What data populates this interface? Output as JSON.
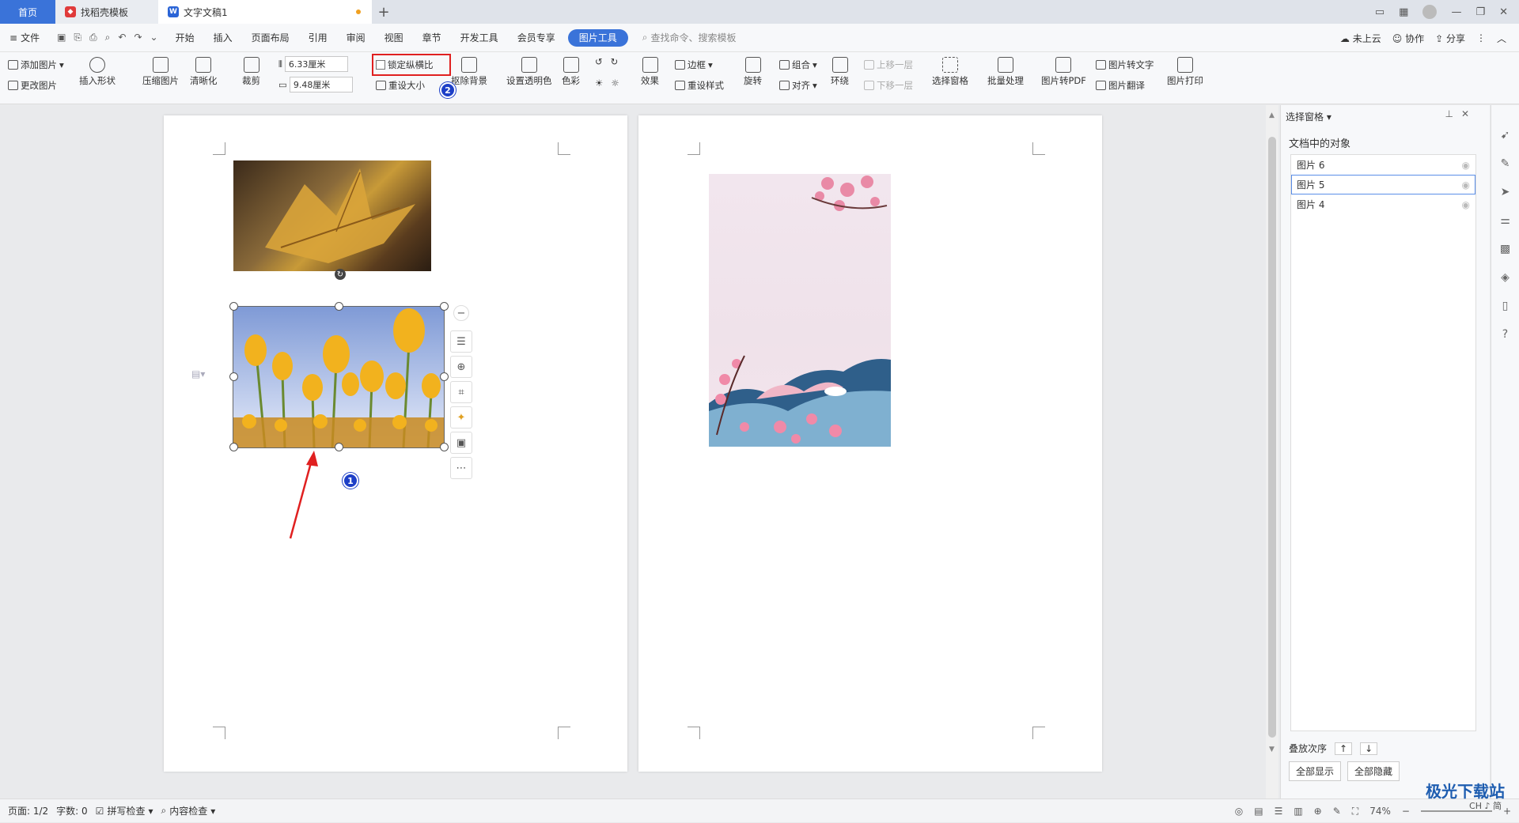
{
  "tabs": {
    "home": "首页",
    "template": "找稻壳模板",
    "document": "文字文稿1",
    "new_tab": "+"
  },
  "menu": {
    "file": "文件",
    "items": [
      "开始",
      "插入",
      "页面布局",
      "引用",
      "审阅",
      "视图",
      "章节",
      "开发工具",
      "会员专享"
    ],
    "active": "图片工具",
    "search": "查找命令、搜索模板",
    "cloud": "未上云",
    "collab": "协作",
    "share": "分享"
  },
  "ribbon": {
    "add_picture": "添加图片",
    "change_picture": "更改图片",
    "insert_shape": "插入形状",
    "compress": "压缩图片",
    "sharpen": "清晰化",
    "crop": "裁剪",
    "width_value": "6.33厘米",
    "height_value": "9.48厘米",
    "lock_ratio": "锁定纵横比",
    "reset_size": "重设大小",
    "remove_bg": "抠除背景",
    "set_transparent": "设置透明色",
    "color": "色彩",
    "effect": "效果",
    "border": "边框",
    "reset_style": "重设样式",
    "rotate": "旋转",
    "group": "组合",
    "align": "对齐",
    "wrap": "环绕",
    "bring_forward": "上移一层",
    "send_backward": "下移一层",
    "selection_pane": "选择窗格",
    "batch": "批量处理",
    "to_pdf": "图片转PDF",
    "to_text": "图片转文字",
    "translate": "图片翻译",
    "print": "图片打印"
  },
  "annotations": {
    "badge1": "1",
    "badge2": "2",
    "highlight_color": "#e02020",
    "badge_color": "#1d3fc7"
  },
  "pane": {
    "title": "选择窗格",
    "section": "文档中的对象",
    "objects": [
      "图片 6",
      "图片 5",
      "图片 4"
    ],
    "selected": "图片 5",
    "order_label": "叠放次序",
    "show_all": "全部显示",
    "hide_all": "全部隐藏"
  },
  "status": {
    "page": "页面: 1/2",
    "words": "字数: 0",
    "spell": "拼写检查",
    "content_check": "内容检查",
    "zoom": "74%"
  },
  "watermark": {
    "brand": "极光下载站",
    "ime": "CH ♪ 简"
  }
}
